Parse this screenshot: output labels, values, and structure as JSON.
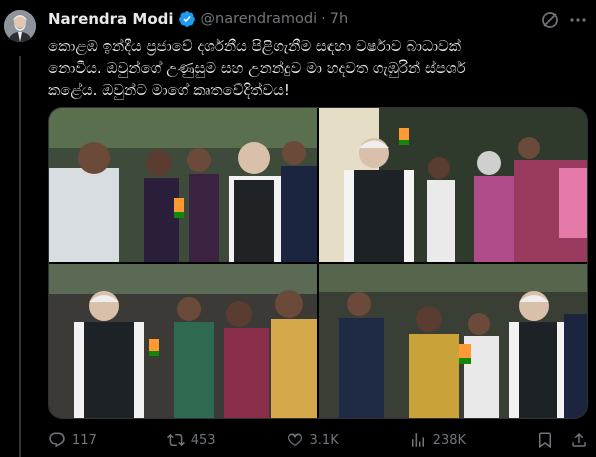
{
  "tweet": {
    "author_name": "Narendra Modi",
    "handle": "@narendramodi",
    "separator": "·",
    "time": "7h",
    "text_line1": "කොළඹ ඉන්දීය ප්‍රජාවේ දර්ශනීය පිළිගැනීම සඳහා වර්ෂාව බාධාවක්",
    "text_line2": "නොවීය. ඔවුන්ගේ උණුසුම සහ උනන්දුව මා හදවත ගැඹුරින් ස්පර්ශ",
    "text_line3": "කළේය. ඔවුන්ට මාගේ කෘතවේදිත්වය!"
  },
  "actions": {
    "replies": "117",
    "reposts": "453",
    "likes": "3.1K",
    "views": "238K"
  },
  "icons": {
    "verified": "verified-badge-icon",
    "grok": "grok-icon",
    "more": "more-options-icon",
    "reply": "reply-icon",
    "repost": "repost-icon",
    "like": "like-icon",
    "views": "views-icon",
    "bookmark": "bookmark-icon",
    "share": "share-icon"
  },
  "colors": {
    "background": "#000000",
    "text": "#e7e9ea",
    "muted": "#71767b",
    "verified": "#1d9bf0"
  }
}
